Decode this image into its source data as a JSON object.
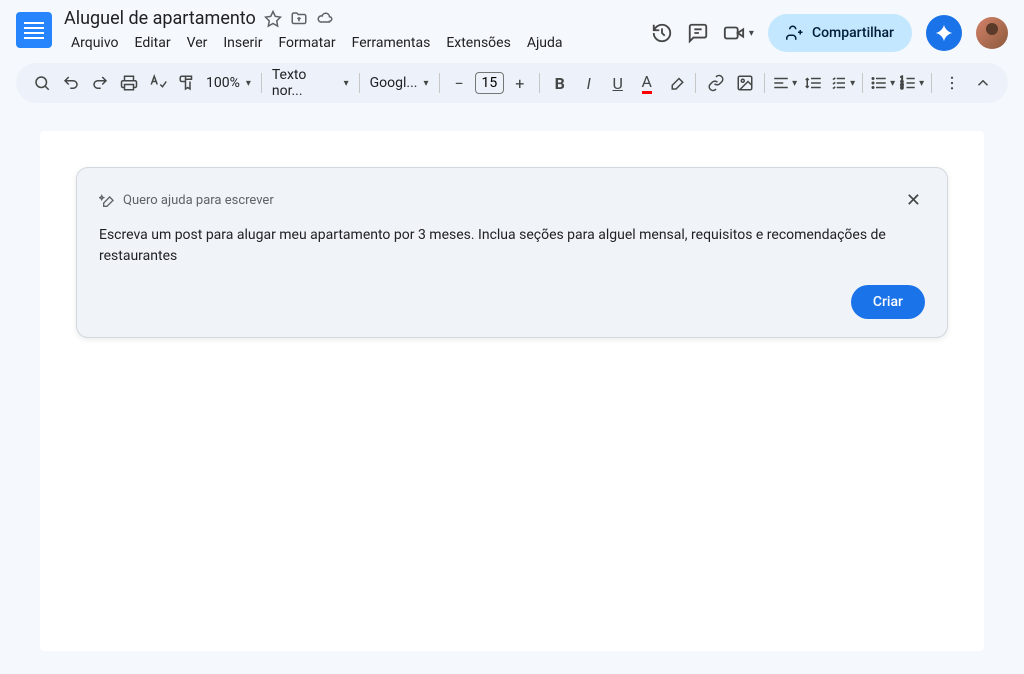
{
  "header": {
    "doc_title": "Aluguel de apartamento",
    "menu": [
      "Arquivo",
      "Editar",
      "Ver",
      "Inserir",
      "Formatar",
      "Ferramentas",
      "Extensões",
      "Ajuda"
    ],
    "share_label": "Compartilhar"
  },
  "toolbar": {
    "zoom": "100%",
    "style": "Texto nor...",
    "font": "Googl...",
    "font_size": "15"
  },
  "help_card": {
    "title": "Quero ajuda para escrever",
    "body": "Escreva um post para alugar meu apartamento por 3 meses. Inclua seções para alguel mensal, requisitos e recomendações de restaurantes",
    "create_label": "Criar"
  }
}
